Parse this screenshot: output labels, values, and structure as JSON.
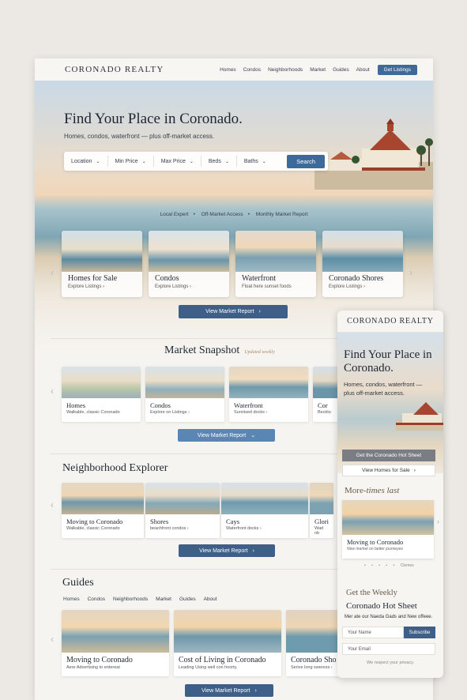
{
  "nav": {
    "brand": "CORONADO REALTY",
    "links": [
      "Homes",
      "Condos",
      "Neighborhoods",
      "Market",
      "Guides",
      "About"
    ],
    "cta": "Get Listings"
  },
  "hero": {
    "title": "Find Your Place in Coronado.",
    "subtitle": "Homes, condos, waterfront — plus off-market access.",
    "filters": [
      "Location",
      "Min Price",
      "Max Price",
      "Beds",
      "Baths"
    ],
    "search_label": "Search",
    "trust": [
      "Local Expert",
      "Off-Market Access",
      "Monthly Market Report"
    ]
  },
  "hero_cards": [
    {
      "title": "Homes for Sale",
      "sub": "Explore Listings ›"
    },
    {
      "title": "Condos",
      "sub": "Explore Listings ›"
    },
    {
      "title": "Waterfront",
      "sub": "Float here sunset foods"
    },
    {
      "title": "Coronado Shores",
      "sub": "Explore Listings ›"
    }
  ],
  "market_btn": "View Market Report",
  "snapshot": {
    "title": "Market Snapshot",
    "script": "Updated weekly",
    "cards": [
      {
        "title": "Homes",
        "sub": "Walkable, classic Coronado"
      },
      {
        "title": "Condos",
        "sub": "Explore on Listings ›"
      },
      {
        "title": "Waterfront",
        "sub": "Sunnised docks ›"
      },
      {
        "title": "Cor",
        "sub": "Beckto"
      }
    ],
    "btn": "View Market Report"
  },
  "explorer": {
    "title": "Neighborhood Explorer",
    "cards": [
      {
        "title": "Moving to Coronado",
        "sub": "Walkable, classic Coronado"
      },
      {
        "title": "Shores",
        "sub": "beachfront condos ›"
      },
      {
        "title": "Cays",
        "sub": "Waterfront docks ›"
      },
      {
        "title": "Glori",
        "sub": "Wad nb"
      }
    ],
    "btn": "View Market Report"
  },
  "guides": {
    "title": "Guides",
    "nav": [
      "Homes",
      "Condos",
      "Neighborhoods",
      "Market",
      "Guides",
      "About"
    ],
    "cards": [
      {
        "title": "Moving to Coronado",
        "sub": "Aere Advertising to entereat"
      },
      {
        "title": "Cost of Living in Coronado",
        "sub": "Leading Using well con hoorty."
      },
      {
        "title": "Coronado Sho",
        "sub": "Serive long sweress ›"
      }
    ],
    "btn": "View Market Report"
  },
  "mobile": {
    "brand": "CORONADO REALTY",
    "title": "Find Your Place in Coronado.",
    "subtitle": "Homes, condos, waterfront — plus off-market access.",
    "btn_primary": "Get the Coronado Hot Sheet",
    "btn_secondary": "View Homes for Sale",
    "more_a": "More-",
    "more_b": "times last",
    "card_title": "Moving to Coronado",
    "card_sub": "New market on better journeyes",
    "dots_label": "Clemes",
    "weekly": "Get the Weekly",
    "hot": "Coronado Hot Sheet",
    "small": "Mer ate our Naeda Gads and New offeee.",
    "name_ph": "Your Name",
    "subscribe": "Subscribe",
    "email_ph": "Your Email",
    "privacy": "We respect your privacy."
  },
  "colors": {
    "accent": "#3d6a9a",
    "button_dark": "#3d5f88",
    "bg": "#ece9e4"
  }
}
